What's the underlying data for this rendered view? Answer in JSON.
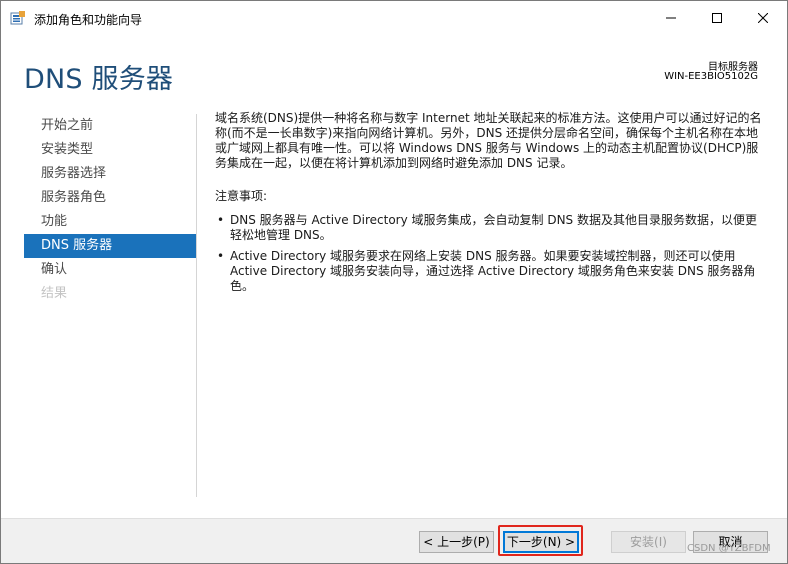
{
  "window": {
    "title": "添加角色和功能向导",
    "minimize_glyph": "—",
    "maximize_glyph": "☐",
    "close_glyph": "✕"
  },
  "header": {
    "title": "DNS 服务器",
    "target_label": "目标服务器",
    "target_value": "WIN-EE3BIO5102G"
  },
  "nav": {
    "items": [
      {
        "label": "开始之前",
        "state": "normal"
      },
      {
        "label": "安装类型",
        "state": "normal"
      },
      {
        "label": "服务器选择",
        "state": "normal"
      },
      {
        "label": "服务器角色",
        "state": "normal"
      },
      {
        "label": "功能",
        "state": "normal"
      },
      {
        "label": "DNS 服务器",
        "state": "active"
      },
      {
        "label": "确认",
        "state": "normal"
      },
      {
        "label": "结果",
        "state": "disabled"
      }
    ]
  },
  "content": {
    "intro": "域名系统(DNS)提供一种将名称与数字 Internet 地址关联起来的标准方法。这使用户可以通过好记的名称(而不是一长串数字)来指向网络计算机。另外，DNS 还提供分层命名空间，确保每个主机名称在本地或广域网上都具有唯一性。可以将 Windows DNS 服务与 Windows 上的动态主机配置协议(DHCP)服务集成在一起，以便在将计算机添加到网络时避免添加 DNS 记录。",
    "notes_heading": "注意事项:",
    "bullet_glyph": "•",
    "bullets": [
      "DNS 服务器与 Active Directory 域服务集成，会自动复制 DNS 数据及其他目录服务数据，以便更轻松地管理 DNS。",
      "Active Directory 域服务要求在网络上安装 DNS 服务器。如果要安装域控制器，则还可以使用 Active Directory 域服务安装向导，通过选择 Active Directory 域服务角色来安装 DNS 服务器角色。"
    ]
  },
  "footer": {
    "prev_label": "< 上一步(P)",
    "next_label": "下一步(N) >",
    "install_label": "安装(I)",
    "cancel_label": "取消"
  },
  "watermark": "CSDN @YZBFDM",
  "colors": {
    "accent": "#1a72bb",
    "title": "#1f4e79",
    "highlight": "#e0261c"
  }
}
